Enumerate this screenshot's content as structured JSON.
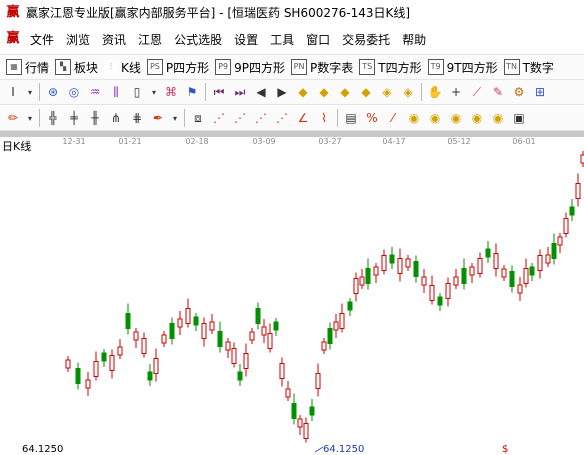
{
  "window": {
    "title": "赢家江恩专业版[赢家内部服务平台] - [恒瑞医药  SH600276-143日K线]"
  },
  "menubar": {
    "items": [
      "文件",
      "浏览",
      "资讯",
      "江恩",
      "公式选股",
      "设置",
      "工具",
      "窗口",
      "交易委托",
      "帮助"
    ]
  },
  "toolbar_main": {
    "buttons": [
      {
        "icon": "table-icon",
        "label": "行情"
      },
      {
        "icon": "blocks-icon",
        "label": "板块"
      },
      {
        "icon": "kline-icon",
        "label": "K线"
      },
      {
        "icon": "ps-icon",
        "icon_text": "PS",
        "label": "P四方形"
      },
      {
        "icon": "p9-icon",
        "icon_text": "P9",
        "label": "9P四方形"
      },
      {
        "icon": "pn-icon",
        "icon_text": "PN",
        "label": "P数字表"
      },
      {
        "icon": "ts-icon",
        "icon_text": "TS",
        "label": "T四方形"
      },
      {
        "icon": "t9-icon",
        "icon_text": "T9",
        "label": "9T四方形"
      },
      {
        "icon": "tn-icon",
        "icon_text": "TN",
        "label": "T数字"
      }
    ]
  },
  "chart": {
    "panel_label": "日K线",
    "date_ticks": [
      "12-31",
      "01-21",
      "02-18",
      "03-09",
      "03-27",
      "04-17",
      "05-12",
      "06-01"
    ],
    "bottom_left_price": "64.1250",
    "low_marker_price": "64.1250",
    "bottom_marker": "$",
    "colors": {
      "up": "#d00000",
      "down": "#009000",
      "tick_bar": "#c8c8c8"
    }
  }
}
